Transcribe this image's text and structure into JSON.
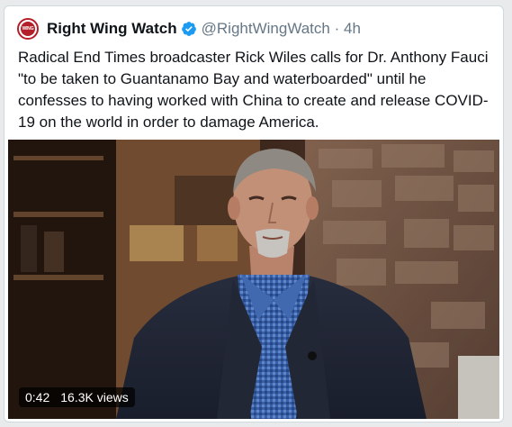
{
  "tweet": {
    "display_name": "Right Wing Watch",
    "handle": "@RightWingWatch",
    "time": "4h",
    "text": "Radical End Times broadcaster Rick Wiles calls for Dr. Anthony Fauci \"to be taken to Guantanamo Bay and waterboarded\" until he confesses to having worked with China to create and release COVID-19 on the world in order to damage America.",
    "avatar_text": "WING"
  },
  "video": {
    "duration": "0:42",
    "views": "16.3K views"
  },
  "colors": {
    "brand": "#b3202a",
    "verified": "#1d9bf0",
    "text": "#0f1419",
    "muted": "#657786"
  }
}
